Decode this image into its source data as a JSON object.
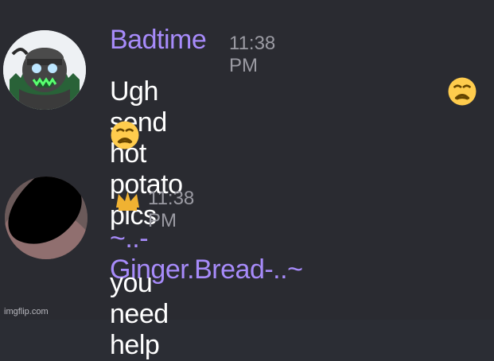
{
  "messages": [
    {
      "author": "Badtime",
      "timestamp": "11:38 PM",
      "text": "Ugh send hot potato pics",
      "emoji_icon": "weary-face-icon"
    },
    {
      "author": "~..-Ginger.Bread-..~",
      "timestamp": "11:38 PM",
      "text": "you need help",
      "badge_icon": "crown-icon"
    }
  ],
  "watermark": "imgflip.com",
  "colors": {
    "background": "#2a2b31",
    "author": "#a78bfa",
    "timestamp": "#9b9ba3",
    "message_text": "#ffffff",
    "crown": "#f0b232"
  }
}
